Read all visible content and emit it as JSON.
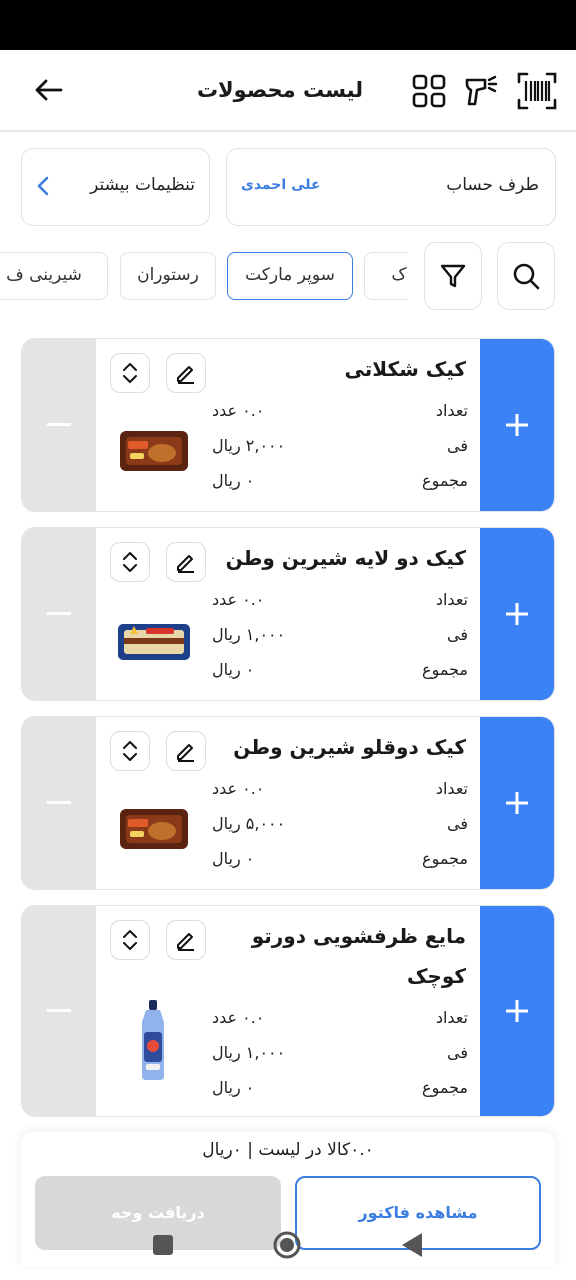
{
  "header": {
    "title": "لیست محصولات",
    "icons": [
      "back-arrow-icon",
      "grid-icon",
      "scanner-icon",
      "barcode-icon"
    ]
  },
  "account": {
    "label": "طرف حساب",
    "value": "علی احمدی"
  },
  "settings": {
    "label": "تنظیمات بیشتر"
  },
  "categories": [
    "پاک",
    "سوپر مارکت",
    "رستوران",
    "شیرینی ف"
  ],
  "active_category": "سوپر مارکت",
  "labels": {
    "qty": "تعداد",
    "price": "فی",
    "total": "مجموع"
  },
  "products": [
    {
      "name": "کیک شکلاتی",
      "qty": "۰.۰ عدد",
      "price": "۲,۰۰۰ ریال",
      "total": "۰ ریال",
      "image": "chocolate-cake-package"
    },
    {
      "name": "کیک دو لایه شیرین وطن",
      "qty": "۰.۰ عدد",
      "price": "۱,۰۰۰ ریال",
      "total": "۰ ریال",
      "image": "layer-cake-package"
    },
    {
      "name": "کیک دوقلو شیرین وطن",
      "qty": "۰.۰ عدد",
      "price": "۵,۰۰۰ ریال",
      "total": "۰ ریال",
      "image": "twin-cake-package"
    },
    {
      "name": "مایع ظرفشویی دورتو کوچک",
      "qty": "۰.۰ عدد",
      "price": "۱,۰۰۰ ریال",
      "total": "۰ ریال",
      "image": "dish-soap-bottle"
    }
  ],
  "summary": "۰.۰کالا در لیست | ۰ریال",
  "buttons": {
    "invoice": "مشاهده فاکتور",
    "payment": "دریافت وجه"
  },
  "colors": {
    "accent": "#3b82f6",
    "link": "#3b7de0",
    "disabled": "#d8d8d8",
    "minus_bg": "#e4e4e4"
  }
}
